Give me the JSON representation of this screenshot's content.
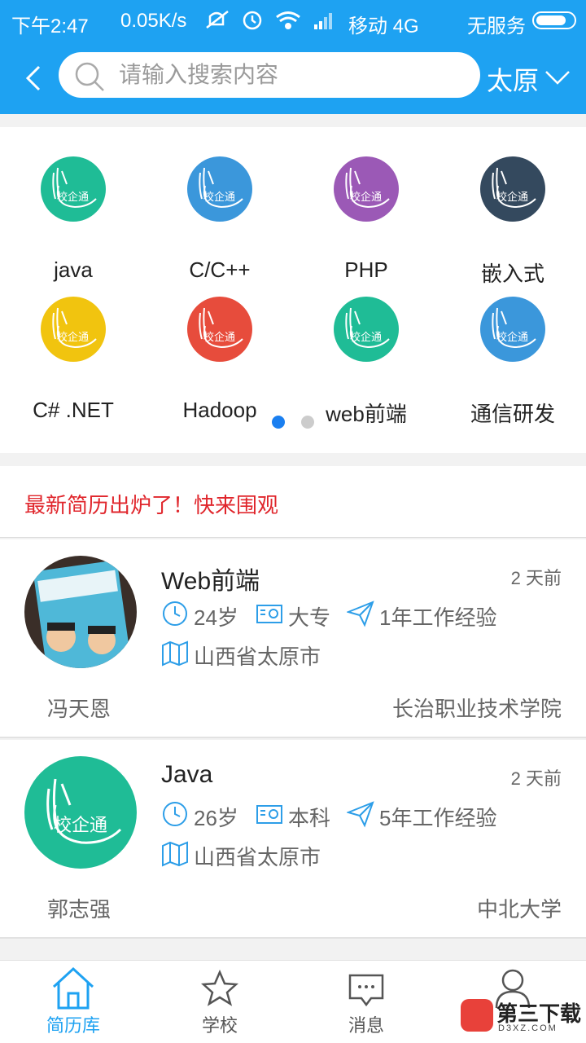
{
  "status_bar": {
    "time": "下午2:47",
    "speed": "0.05K/s",
    "carrier": "移动 4G",
    "no_service": "无服务"
  },
  "header": {
    "search_placeholder": "请输入搜索内容",
    "city": "太原"
  },
  "categories": [
    {
      "name": "java",
      "color": "#1fbc96",
      "logo_text": "校企通"
    },
    {
      "name": "C/C++",
      "color": "#3b97db",
      "logo_text": "校企通"
    },
    {
      "name": "PHP",
      "color": "#9b59b6",
      "logo_text": "校企通"
    },
    {
      "name": "嵌入式",
      "color": "#34495e",
      "logo_text": "校企通"
    },
    {
      "name": "C# .NET",
      "color": "#f1c40f",
      "logo_text": "校企通"
    },
    {
      "name": "Hadoop",
      "color": "#e74c3c",
      "logo_text": "校企通"
    },
    {
      "name": "web前端",
      "color": "#1fbc96",
      "logo_text": "校企通"
    },
    {
      "name": "通信研发",
      "color": "#3b97db",
      "logo_text": "校企通"
    }
  ],
  "pager": {
    "active_index": 0,
    "count": 2,
    "active_color": "#1a7ff0",
    "inactive_color": "#cccccc"
  },
  "notice": "最新简历出炉了！快来围观",
  "resumes": [
    {
      "title": "Web前端",
      "ago": "2 天前",
      "age": "24岁",
      "education": "大专",
      "experience": "1年工作经验",
      "location": "山西省太原市",
      "person": "冯天恩",
      "school": "长治职业技术学院",
      "avatar_type": "photo"
    },
    {
      "title": "Java",
      "ago": "2 天前",
      "age": "26岁",
      "education": "本科",
      "experience": "5年工作经验",
      "location": "山西省太原市",
      "person": "郭志强",
      "school": "中北大学",
      "avatar_type": "logo",
      "avatar_logo_text": "校企通"
    }
  ],
  "bottom_nav": [
    {
      "label": "简历库",
      "icon": "home-icon",
      "active": true
    },
    {
      "label": "学校",
      "icon": "star-icon",
      "active": false
    },
    {
      "label": "消息",
      "icon": "message-icon",
      "active": false
    },
    {
      "label": "",
      "icon": "user-icon",
      "active": false
    }
  ],
  "watermark": {
    "text": "第三下载",
    "sub": "D3XZ.COM"
  },
  "colors": {
    "primary": "#1ea2f2",
    "notice_red": "#e0262c"
  }
}
